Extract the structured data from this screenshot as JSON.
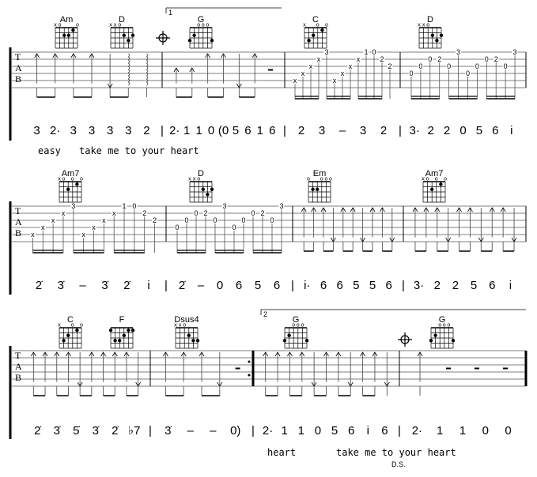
{
  "tab_clef": [
    "T",
    "A",
    "B"
  ],
  "systems": [
    {
      "chords": [
        {
          "name": "Am",
          "marks": "xo   o",
          "dots": [
            [
              2,
              1
            ],
            [
              3,
              2
            ],
            [
              4,
              2
            ]
          ]
        },
        {
          "name": "D",
          "marks": "xxo   ",
          "dots": [
            [
              3,
              2
            ],
            [
              1,
              2
            ],
            [
              2,
              3
            ]
          ]
        },
        {
          "name": "G",
          "marks": "  ooo ",
          "dots": [
            [
              5,
              2
            ],
            [
              6,
              3
            ],
            [
              1,
              3
            ]
          ]
        },
        {
          "name": "C",
          "marks": "x  o o",
          "dots": [
            [
              2,
              1
            ],
            [
              4,
              2
            ],
            [
              5,
              3
            ]
          ]
        },
        {
          "name": "D",
          "marks": "xxo   ",
          "dots": [
            [
              3,
              2
            ],
            [
              1,
              2
            ],
            [
              2,
              3
            ]
          ]
        }
      ],
      "coda": true,
      "volta": "1",
      "measures": [
        {
          "strums": [
            "up",
            "up",
            "up",
            "up",
            "down",
            "arp",
            "arp"
          ],
          "notes": [
            "3",
            "2·",
            "3",
            "3",
            "3",
            "3",
            "2"
          ]
        },
        {
          "strums": [
            "up-short",
            "up-short",
            "up",
            "up",
            "down",
            "up",
            "rest"
          ],
          "notes": [
            "2·",
            "1",
            "1",
            "0",
            "(0",
            "5",
            "6",
            "1",
            "6"
          ]
        },
        {
          "picking": [
            [
              5,
              "x"
            ],
            [
              4,
              "x"
            ],
            [
              3,
              "x"
            ],
            [
              2,
              "x"
            ],
            [
              1,
              "3"
            ],
            [
              5,
              "x"
            ],
            [
              4,
              "x"
            ],
            [
              3,
              "x"
            ],
            [
              2,
              "x"
            ],
            [
              1,
              "1"
            ],
            [
              1,
              "0"
            ],
            [
              2,
              "2"
            ],
            [
              3,
              "2"
            ]
          ],
          "notes": [
            "2",
            "3",
            "–",
            "3",
            "2"
          ]
        },
        {
          "picking": [
            [
              4,
              "0"
            ],
            [
              3,
              "0"
            ],
            [
              2,
              "0"
            ],
            [
              2,
              "2"
            ],
            [
              3,
              "0"
            ],
            [
              1,
              "3"
            ],
            [
              4,
              "0"
            ],
            [
              3,
              "0"
            ],
            [
              2,
              "0"
            ],
            [
              2,
              "2"
            ],
            [
              3,
              "0"
            ],
            [
              1,
              "3"
            ]
          ],
          "notes": [
            "3·",
            "2",
            "2",
            "0",
            "5",
            "6",
            "i"
          ]
        }
      ],
      "lyrics": [
        "easy",
        "take me to your heart"
      ]
    },
    {
      "chords": [
        {
          "name": "Am7",
          "marks": "xo o o",
          "dots": [
            [
              2,
              1
            ],
            [
              4,
              2
            ]
          ]
        },
        {
          "name": "D",
          "marks": "xxo   ",
          "dots": [
            [
              3,
              2
            ],
            [
              1,
              2
            ],
            [
              2,
              3
            ]
          ]
        },
        {
          "name": "Em",
          "marks": "o  ooo",
          "dots": [
            [
              5,
              2
            ],
            [
              4,
              2
            ]
          ]
        },
        {
          "name": "Am7",
          "marks": "xo o o",
          "dots": [
            [
              2,
              1
            ],
            [
              4,
              2
            ]
          ]
        }
      ],
      "measures": [
        {
          "picking": [
            [
              5,
              "x"
            ],
            [
              4,
              "x"
            ],
            [
              3,
              "x"
            ],
            [
              2,
              "x"
            ],
            [
              1,
              "3"
            ],
            [
              5,
              "x"
            ],
            [
              4,
              "x"
            ],
            [
              3,
              "x"
            ],
            [
              2,
              "x"
            ],
            [
              1,
              "1"
            ],
            [
              1,
              "0"
            ],
            [
              2,
              "2"
            ],
            [
              3,
              "2"
            ]
          ],
          "notes": [
            "2̇",
            "3̇",
            "–",
            "3̇",
            "2̇",
            "i"
          ]
        },
        {
          "picking": [
            [
              4,
              "0"
            ],
            [
              3,
              "0"
            ],
            [
              2,
              "0"
            ],
            [
              2,
              "2"
            ],
            [
              3,
              "0"
            ],
            [
              1,
              "3"
            ],
            [
              4,
              "0"
            ],
            [
              3,
              "0"
            ],
            [
              2,
              "0"
            ],
            [
              2,
              "2"
            ],
            [
              3,
              "0"
            ],
            [
              1,
              "3"
            ]
          ],
          "notes": [
            "2̇",
            "–",
            "0",
            "6",
            "5",
            "6"
          ]
        },
        {
          "strums": [
            "up",
            "up",
            "up",
            "down",
            "up",
            "up",
            "down",
            "up",
            "up",
            "down"
          ],
          "notes": [
            "i·",
            "6",
            "6",
            "5",
            "5",
            "6"
          ]
        },
        {
          "strums": [
            "up",
            "up",
            "up",
            "down",
            "up",
            "up",
            "down",
            "up",
            "up",
            "down"
          ],
          "notes": [
            "3·",
            "2",
            "2",
            "5",
            "6",
            "i"
          ]
        }
      ],
      "lyrics": []
    },
    {
      "chords": [
        {
          "name": "C",
          "marks": "x  o o",
          "dots": [
            [
              2,
              1
            ],
            [
              4,
              2
            ],
            [
              5,
              3
            ]
          ]
        },
        {
          "name": "F",
          "marks": "      ",
          "dots": [
            [
              1,
              1
            ],
            [
              2,
              1
            ],
            [
              6,
              1
            ],
            [
              3,
              2
            ],
            [
              4,
              3
            ],
            [
              5,
              3
            ]
          ]
        },
        {
          "name": "Dsus4",
          "marks": "xxo   ",
          "dots": [
            [
              3,
              2
            ],
            [
              1,
              3
            ],
            [
              2,
              3
            ]
          ]
        },
        {
          "name": "G",
          "marks": "  ooo ",
          "dots": [
            [
              5,
              2
            ],
            [
              6,
              3
            ],
            [
              1,
              3
            ]
          ]
        },
        {
          "name": "G",
          "marks": "  ooo ",
          "dots": [
            [
              5,
              2
            ],
            [
              6,
              3
            ],
            [
              1,
              3
            ]
          ]
        }
      ],
      "coda": true,
      "volta": "2",
      "measures": [
        {
          "strums": [
            "up",
            "up",
            "up",
            "up",
            "down",
            "up",
            "up",
            "up",
            "up",
            "down"
          ],
          "notes": [
            "2̇",
            "3̇",
            "5̇",
            "3̇",
            "2̇",
            "♭7"
          ]
        },
        {
          "strums": [
            "up",
            "up",
            "up",
            "down",
            "rest"
          ],
          "notes": [
            "3̇",
            "–",
            "–",
            "0)"
          ],
          "repeat_end": true
        },
        {
          "strums": [
            "up",
            "up",
            "up",
            "up",
            "down",
            "up",
            "up",
            "down",
            "up",
            "up",
            "down"
          ],
          "notes": [
            "2·",
            "1",
            "1",
            "0",
            "5",
            "6",
            "i",
            "6"
          ]
        },
        {
          "strums": [
            "up",
            "rest",
            "rest",
            "rest"
          ],
          "notes": [
            "2·",
            "1",
            "1",
            "0",
            "0"
          ]
        }
      ],
      "lyrics": [
        "heart",
        "take me to your heart"
      ],
      "ds": "D.S."
    }
  ]
}
